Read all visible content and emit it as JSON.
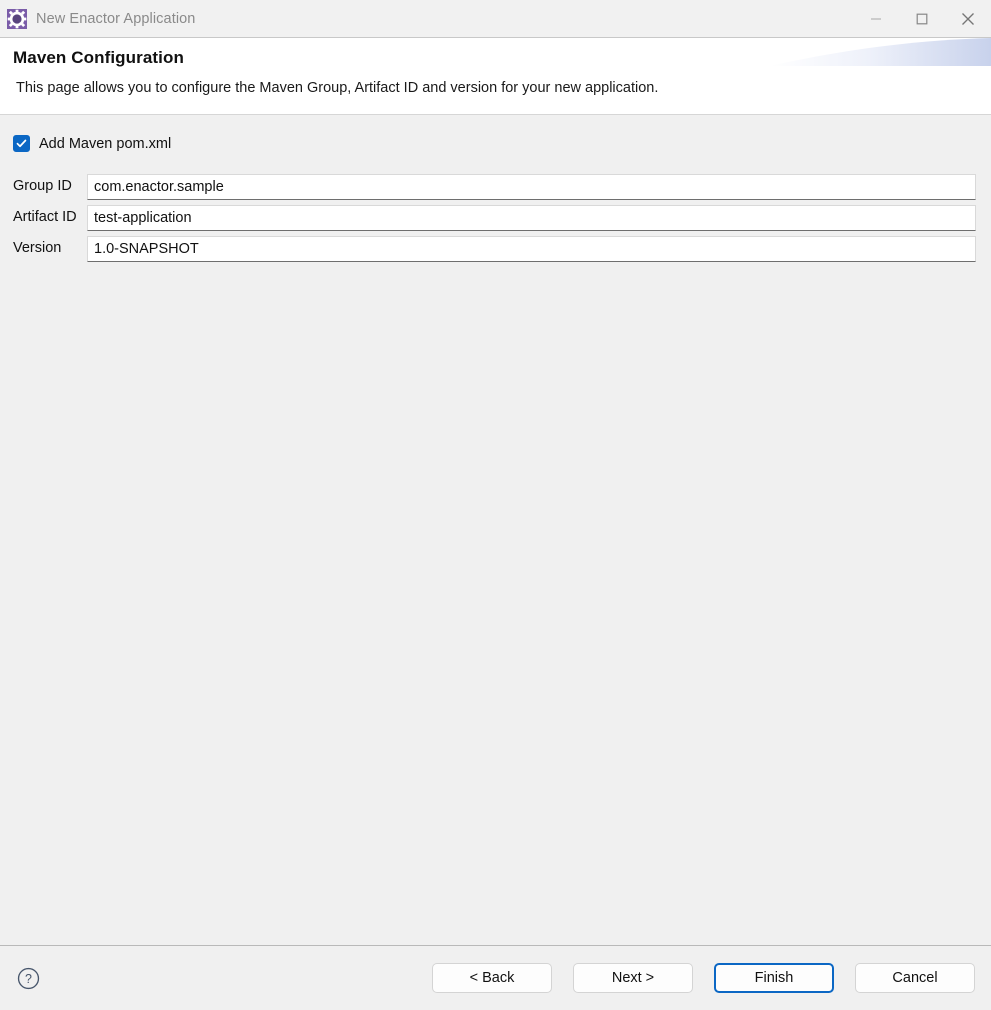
{
  "window": {
    "title": "New Enactor Application",
    "app_icon": "enactor-gear-icon",
    "controls": {
      "minimize": "minimize-icon",
      "maximize": "maximize-icon",
      "close": "close-icon"
    }
  },
  "header": {
    "title": "Maven Configuration",
    "description": "This page allows you to configure the Maven Group, Artifact ID and version for your new application."
  },
  "form": {
    "checkbox": {
      "label": "Add Maven pom.xml",
      "checked": true
    },
    "fields": [
      {
        "label": "Group ID",
        "value": "com.enactor.sample",
        "placeholder": ""
      },
      {
        "label": "Artifact ID",
        "value": "test-application",
        "placeholder": ""
      },
      {
        "label": "Version",
        "value": "1.0-SNAPSHOT",
        "placeholder": ""
      }
    ]
  },
  "footer": {
    "help_icon": "help-circle-icon",
    "buttons": {
      "back": "< Back",
      "next": "Next >",
      "finish": "Finish",
      "cancel": "Cancel"
    }
  },
  "colors": {
    "accent": "#0b67c4",
    "titlebar_bg": "#f1f1f1",
    "body_bg": "#f0f0f0",
    "header_bg": "#ffffff",
    "icon_purple": "#6f4f9e",
    "help_icon": "#46556b"
  }
}
